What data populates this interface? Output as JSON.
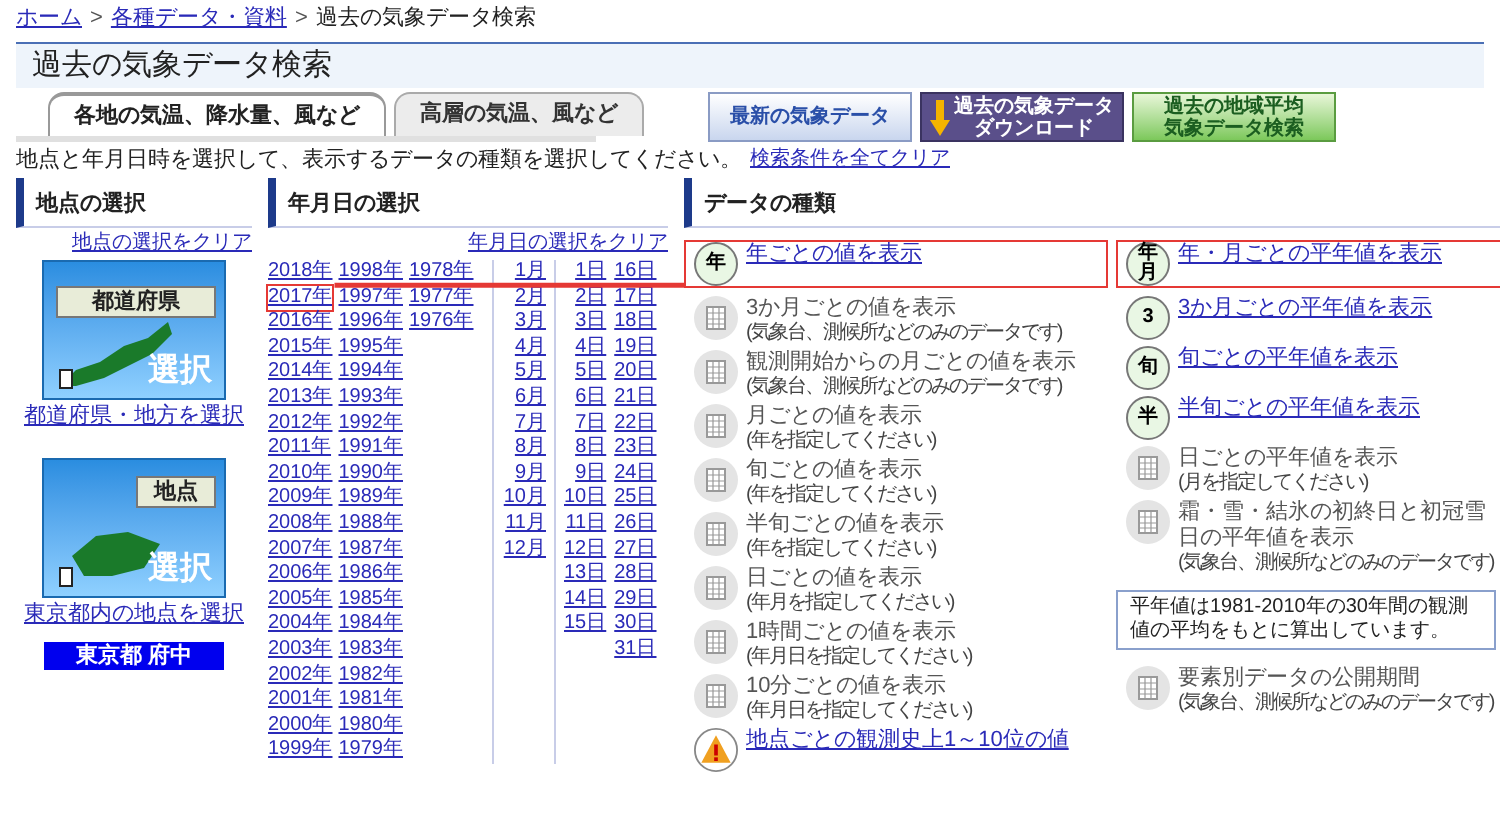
{
  "breadcrumb_separator": ">",
  "breadcrumb": [
    {
      "label": "ホーム",
      "kind": "link"
    },
    {
      "label": "各種データ・資料",
      "kind": "link"
    },
    {
      "label": "過去の気象データ検索",
      "kind": "current"
    }
  ],
  "page_title": "過去の気象データ検索",
  "tabs": [
    {
      "label": "各地の気温、降水量、風など",
      "selected": true
    },
    {
      "label": "高層の気温、風など",
      "selected": false
    }
  ],
  "banners": [
    {
      "kind": "latest",
      "lines": [
        "最新の気象データ"
      ]
    },
    {
      "kind": "download",
      "lines": [
        "過去の気象データ",
        "ダウンロード"
      ]
    },
    {
      "kind": "regional",
      "lines": [
        "過去の地域平均",
        "気象データ検索"
      ]
    }
  ],
  "instruction": "地点と年月日時を選択して、表示するデータの種類を選択してください。",
  "clear_all": "検索条件を全てクリア",
  "location": {
    "heading": "地点の選択",
    "clear": "地点の選択をクリア",
    "options": [
      {
        "kind": "prefecture",
        "badge": "都道府県",
        "action": "選択",
        "link": "都道府県・地方を選択"
      },
      {
        "kind": "station",
        "badge": "地点",
        "action": "選択",
        "link": "東京都内の地点を選択"
      }
    ],
    "selected": "東京都 府中"
  },
  "date": {
    "heading": "年月日の選択",
    "clear": "年月日の選択をクリア",
    "years": [
      {
        "label": "2018年",
        "selected": false
      },
      {
        "label": "2017年",
        "selected": true
      },
      {
        "label": "2016年",
        "selected": false
      },
      {
        "label": "2015年",
        "selected": false
      },
      {
        "label": "2014年",
        "selected": false
      },
      {
        "label": "2013年",
        "selected": false
      },
      {
        "label": "2012年",
        "selected": false
      },
      {
        "label": "2011年",
        "selected": false
      },
      {
        "label": "2010年",
        "selected": false
      },
      {
        "label": "2009年",
        "selected": false
      },
      {
        "label": "2008年",
        "selected": false
      },
      {
        "label": "2007年",
        "selected": false
      },
      {
        "label": "2006年",
        "selected": false
      },
      {
        "label": "2005年",
        "selected": false
      },
      {
        "label": "2004年",
        "selected": false
      },
      {
        "label": "2003年",
        "selected": false
      },
      {
        "label": "2002年",
        "selected": false
      },
      {
        "label": "2001年",
        "selected": false
      },
      {
        "label": "2000年",
        "selected": false
      },
      {
        "label": "1999年",
        "selected": false
      },
      {
        "label": "1998年",
        "selected": false
      },
      {
        "label": "1997年",
        "selected": false
      },
      {
        "label": "1996年",
        "selected": false
      },
      {
        "label": "1995年",
        "selected": false
      },
      {
        "label": "1994年",
        "selected": false
      },
      {
        "label": "1993年",
        "selected": false
      },
      {
        "label": "1992年",
        "selected": false
      },
      {
        "label": "1991年",
        "selected": false
      },
      {
        "label": "1990年",
        "selected": false
      },
      {
        "label": "1989年",
        "selected": false
      },
      {
        "label": "1988年",
        "selected": false
      },
      {
        "label": "1987年",
        "selected": false
      },
      {
        "label": "1986年",
        "selected": false
      },
      {
        "label": "1985年",
        "selected": false
      },
      {
        "label": "1984年",
        "selected": false
      },
      {
        "label": "1983年",
        "selected": false
      },
      {
        "label": "1982年",
        "selected": false
      },
      {
        "label": "1981年",
        "selected": false
      },
      {
        "label": "1980年",
        "selected": false
      },
      {
        "label": "1979年",
        "selected": false
      },
      {
        "label": "1978年",
        "selected": false
      },
      {
        "label": "1977年",
        "selected": false
      },
      {
        "label": "1976年",
        "selected": false
      }
    ],
    "months": [
      "1月",
      "2月",
      "3月",
      "4月",
      "5月",
      "6月",
      "7月",
      "8月",
      "9月",
      "10月",
      "11月",
      "12月"
    ],
    "days": [
      "1日",
      "2日",
      "3日",
      "4日",
      "5日",
      "6日",
      "7日",
      "8日",
      "9日",
      "10日",
      "11日",
      "12日",
      "13日",
      "14日",
      "15日",
      "16日",
      "17日",
      "18日",
      "19日",
      "20日",
      "21日",
      "22日",
      "23日",
      "24日",
      "25日",
      "26日",
      "27日",
      "28日",
      "29日",
      "30日",
      "31日"
    ]
  },
  "data_types": {
    "heading": "データの種類",
    "left": [
      {
        "kind": "link",
        "label": "年ごとの値を表示",
        "icon_text": "年",
        "highlighted": true
      },
      {
        "kind": "disabled",
        "label": "3か月ごとの値を表示",
        "note": "(気象台、測候所などのみのデータです)",
        "highlighted": false
      },
      {
        "kind": "disabled",
        "label": "観測開始からの月ごとの値を表示",
        "note": "(気象台、測候所などのみのデータです)",
        "highlighted": false
      },
      {
        "kind": "disabled",
        "label": "月ごとの値を表示",
        "note": "(年を指定してください)",
        "highlighted": false
      },
      {
        "kind": "disabled",
        "label": "旬ごとの値を表示",
        "note": "(年を指定してください)",
        "highlighted": false
      },
      {
        "kind": "disabled",
        "label": "半旬ごとの値を表示",
        "note": "(年を指定してください)",
        "highlighted": false
      },
      {
        "kind": "disabled",
        "label": "日ごとの値を表示",
        "note": "(年月を指定してください)",
        "highlighted": false
      },
      {
        "kind": "disabled",
        "label": "1時間ごとの値を表示",
        "note": "(年月日を指定してください)",
        "highlighted": false
      },
      {
        "kind": "disabled",
        "label": "10分ごとの値を表示",
        "note": "(年月日を指定してください)",
        "highlighted": false
      },
      {
        "kind": "warning",
        "label": "地点ごとの観測史上1～10位の値",
        "highlighted": false
      }
    ],
    "right": [
      {
        "kind": "link",
        "label": "年・月ごとの平年値を表示",
        "icon_text": "年月",
        "highlighted": true
      },
      {
        "kind": "link",
        "label": "3か月ごとの平年値を表示",
        "icon_text": "3",
        "highlighted": false
      },
      {
        "kind": "link",
        "label": "旬ごとの平年値を表示",
        "icon_text": "旬",
        "highlighted": false
      },
      {
        "kind": "link",
        "label": "半旬ごとの平年値を表示",
        "icon_text": "半",
        "highlighted": false
      },
      {
        "kind": "disabled",
        "label": "日ごとの平年値を表示",
        "note": "(月を指定してください)",
        "highlighted": false
      },
      {
        "kind": "disabled",
        "label": "霜・雪・結氷の初終日と初冠雪日の平年値を表示",
        "note": "(気象台、測候所などのみのデータです)",
        "highlighted": false
      },
      {
        "kind": "note",
        "label": "平年値は1981-2010年の30年間の観測値の平均をもとに算出しています。"
      },
      {
        "kind": "disabled",
        "label": "要素別データの公開期間",
        "note": "(気象台、測候所などのみのデータです)",
        "highlighted": false
      }
    ]
  }
}
